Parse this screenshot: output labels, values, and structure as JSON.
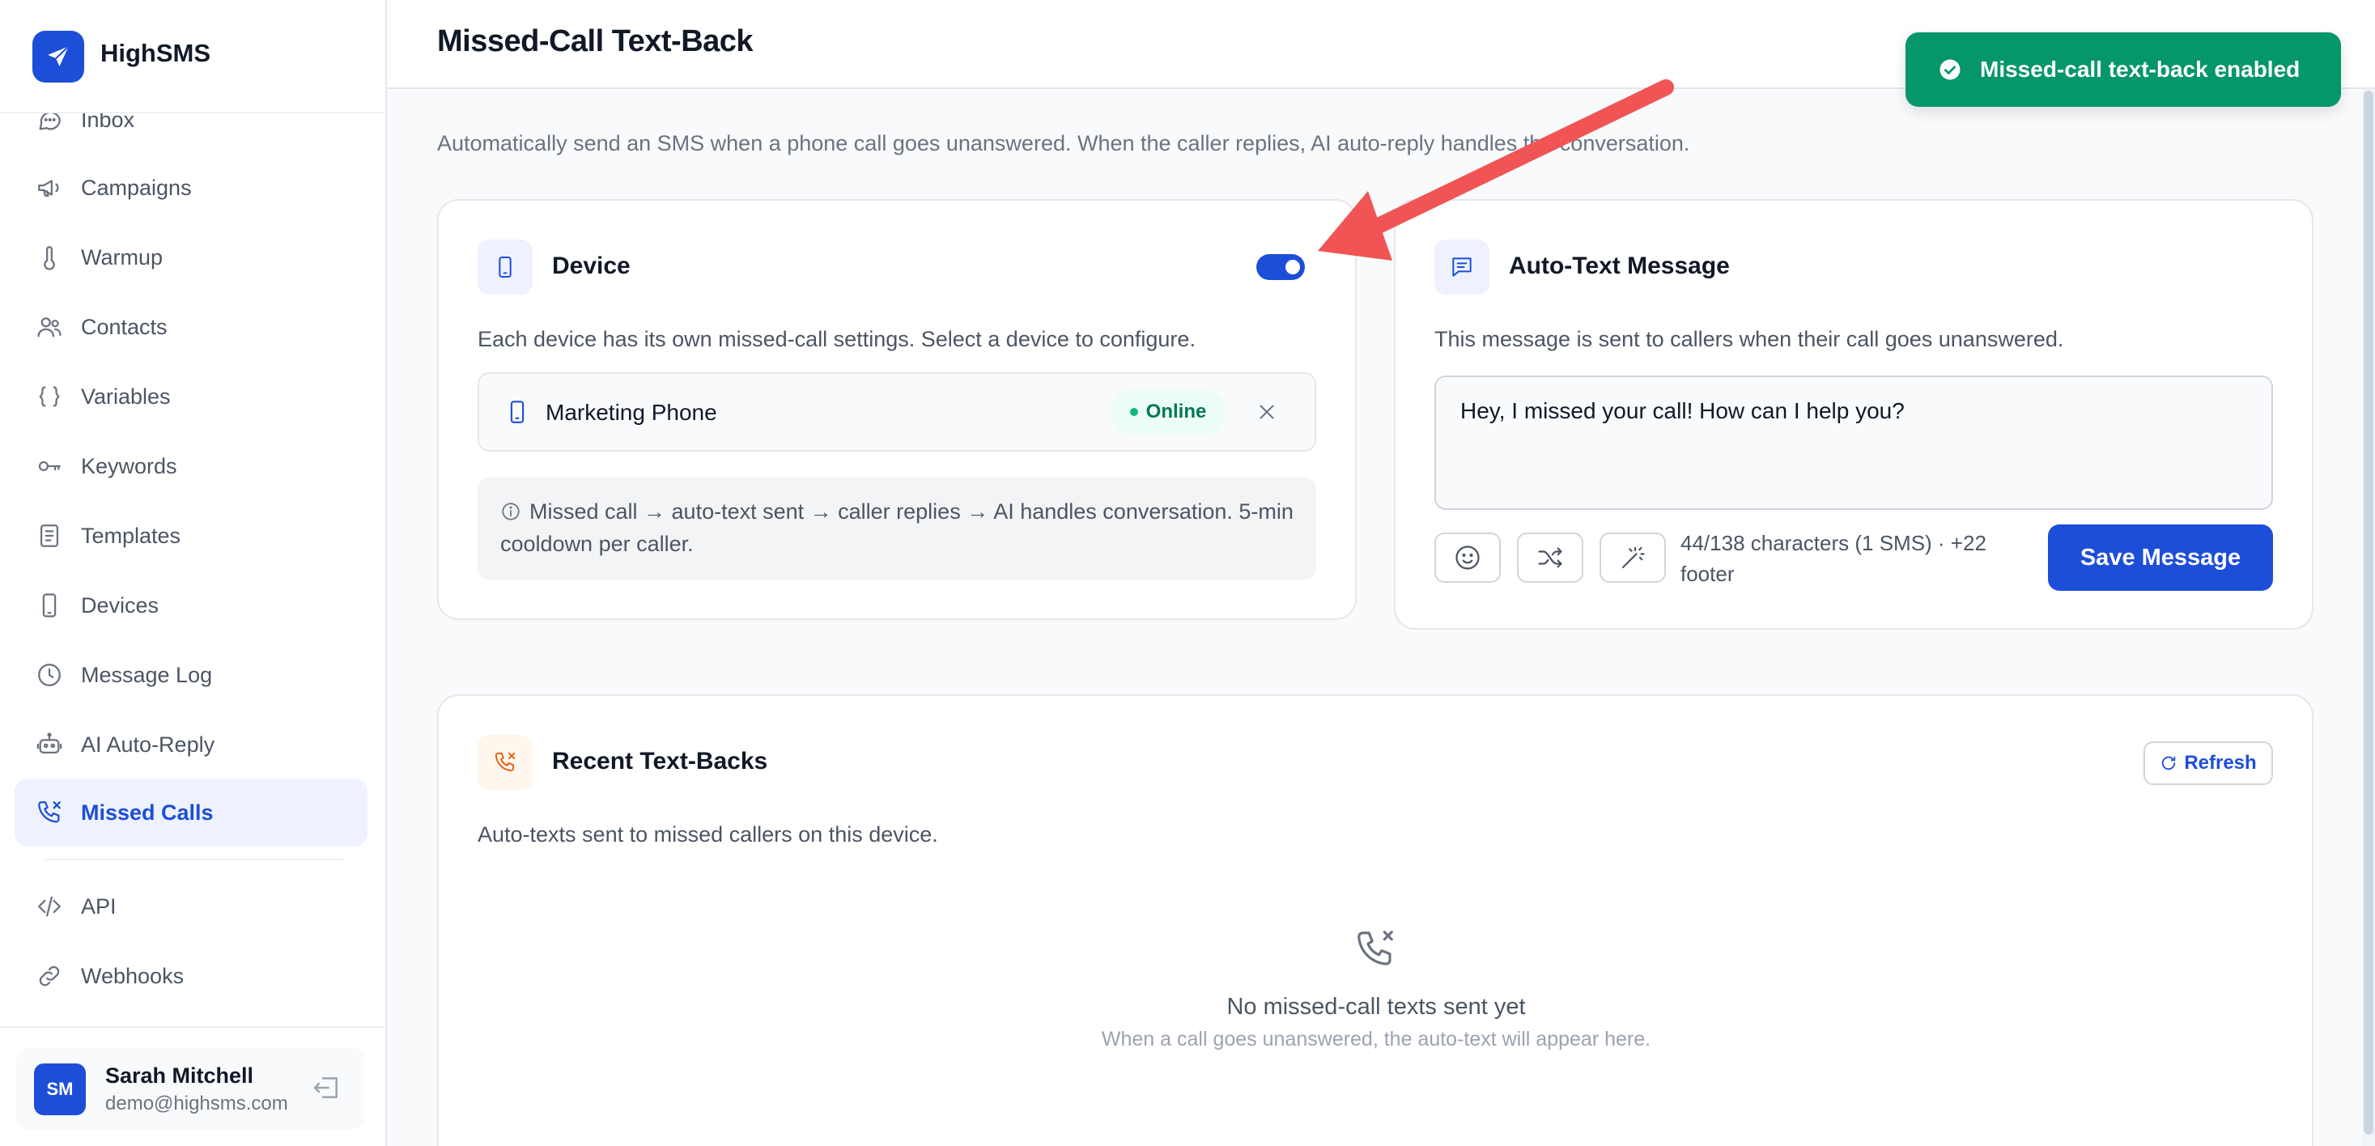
{
  "brand": {
    "name": "HighSMS",
    "accent": "#1d4ed8"
  },
  "sidebar": {
    "items": [
      {
        "label": "Inbox",
        "icon": "chat-icon"
      },
      {
        "label": "Campaigns",
        "icon": "megaphone-icon"
      },
      {
        "label": "Warmup",
        "icon": "thermometer-icon"
      },
      {
        "label": "Contacts",
        "icon": "users-icon"
      },
      {
        "label": "Variables",
        "icon": "braces-icon"
      },
      {
        "label": "Keywords",
        "icon": "key-icon"
      },
      {
        "label": "Templates",
        "icon": "document-icon"
      },
      {
        "label": "Devices",
        "icon": "phone-icon"
      },
      {
        "label": "Message Log",
        "icon": "clock-icon"
      },
      {
        "label": "AI Auto-Reply",
        "icon": "robot-icon"
      },
      {
        "label": "Missed Calls",
        "icon": "phone-missed-icon",
        "active": true
      },
      {
        "label": "API",
        "icon": "code-icon"
      },
      {
        "label": "Webhooks",
        "icon": "link-icon"
      }
    ]
  },
  "user": {
    "initials": "SM",
    "name": "Sarah Mitchell",
    "email": "demo@highsms.com"
  },
  "page": {
    "title": "Missed-Call Text-Back",
    "subtitle": "Automatically send an SMS when a phone call goes unanswered. When the caller replies, AI auto-reply handles the conversation."
  },
  "device_card": {
    "title": "Device",
    "enabled": true,
    "description": "Each device has its own missed-call settings. Select a device to configure.",
    "device": {
      "name": "Marketing Phone",
      "status": "Online"
    },
    "info": "Missed call → auto-text sent → caller replies → AI handles conversation. 5-min cooldown per caller."
  },
  "message_card": {
    "title": "Auto-Text Message",
    "description": "This message is sent to callers when their call goes unanswered.",
    "message": "Hey, I missed your call! How can I help you?",
    "char_count": "44/138 characters (1 SMS) · +22 footer",
    "save_label": "Save Message"
  },
  "recent_card": {
    "title": "Recent Text-Backs",
    "description": "Auto-texts sent to missed callers on this device.",
    "refresh_label": "Refresh",
    "empty_title": "No missed-call texts sent yet",
    "empty_subtitle": "When a call goes unanswered, the auto-text will appear here."
  },
  "toast": {
    "message": "Missed-call text-back enabled",
    "color": "#059669"
  },
  "annotation": {
    "color": "#f05454"
  }
}
